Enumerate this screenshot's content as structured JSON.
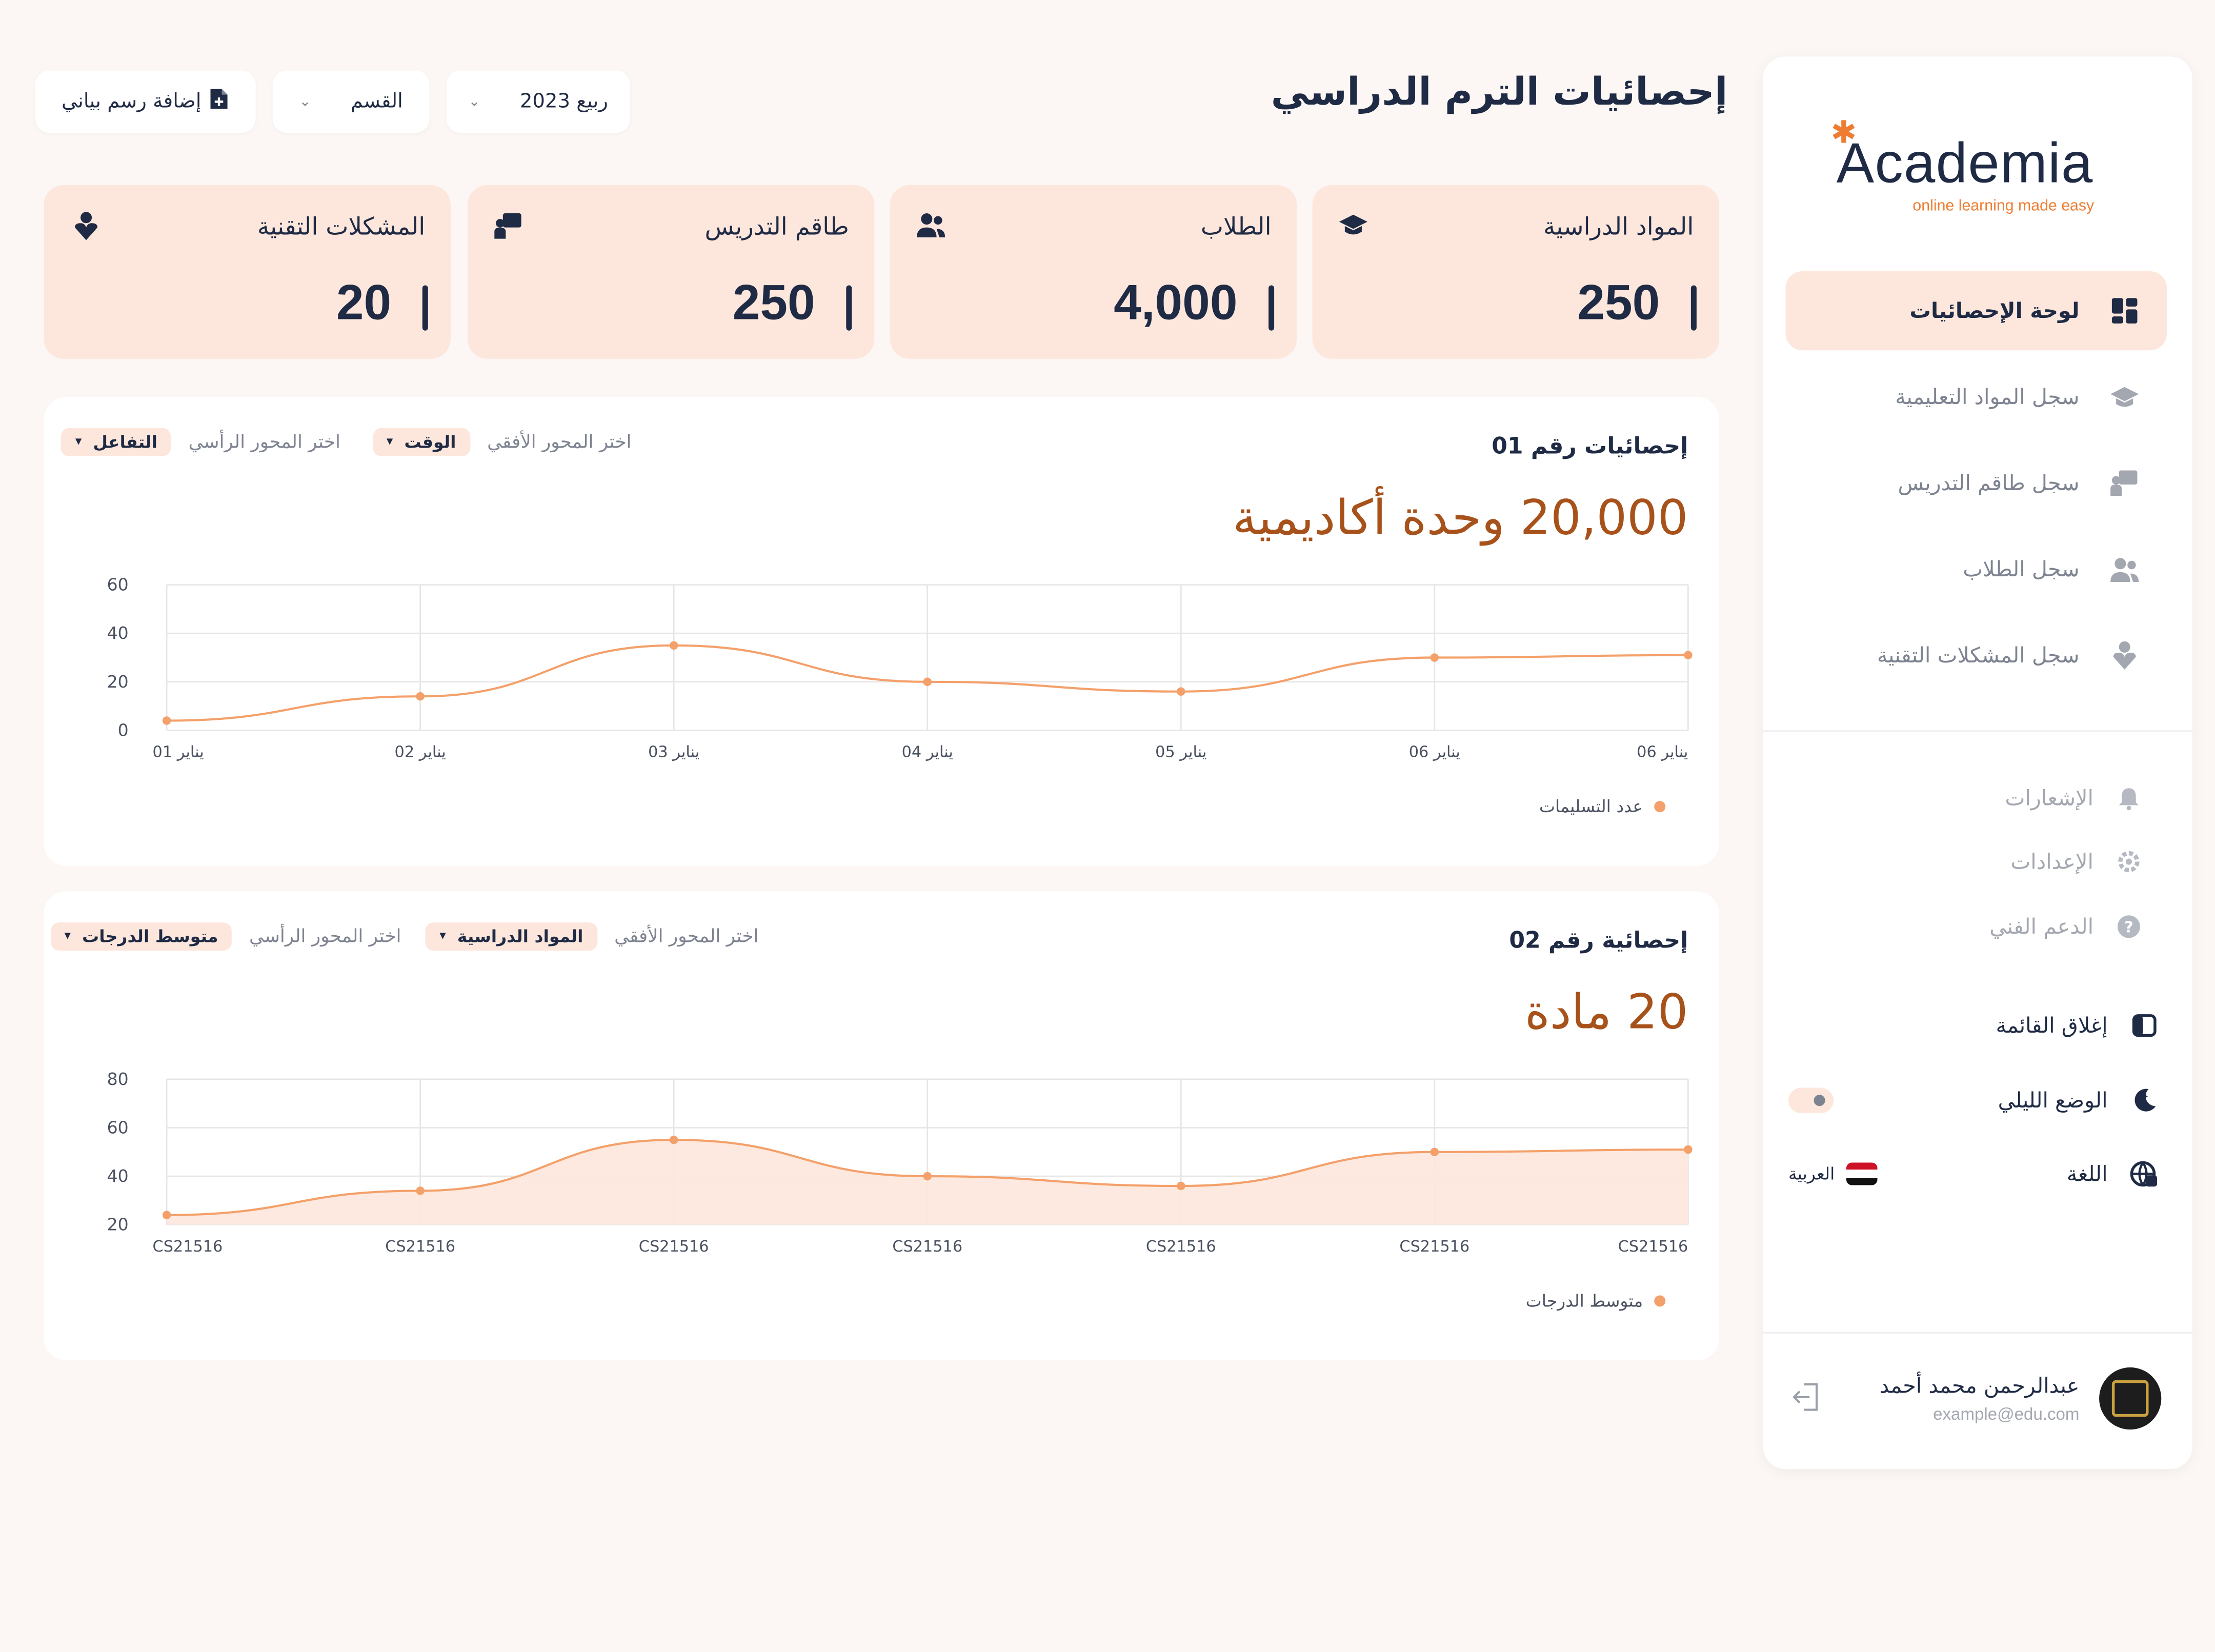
{
  "brand": {
    "name": "Academia",
    "tagline": "online learning made easy",
    "accent": "#ee7d33"
  },
  "sidebar": {
    "items": [
      {
        "label": "لوحة الإحصائيات",
        "icon": "dashboard-icon",
        "active": true
      },
      {
        "label": "سجل المواد التعليمية",
        "icon": "graduation-cap-icon"
      },
      {
        "label": "سجل طاقم التدريس",
        "icon": "teacher-icon"
      },
      {
        "label": "سجل الطلاب",
        "icon": "students-icon"
      },
      {
        "label": "سجل المشكلات التقنية",
        "icon": "issue-icon"
      }
    ],
    "secondary": [
      {
        "label": "الإشعارات",
        "icon": "bell-icon"
      },
      {
        "label": "الإعدادات",
        "icon": "gear-icon"
      },
      {
        "label": "الدعم الفني",
        "icon": "help-icon"
      }
    ],
    "collapse_label": "إغلاق القائمة",
    "night_mode_label": "الوضع الليلي",
    "language_label": "اللغة",
    "language_value": "العربية",
    "user": {
      "name": "عبدالرحمن محمد أحمد",
      "email": "example@edu.com"
    }
  },
  "header": {
    "title": "إحصائيات الترم الدراسي",
    "term_select": "ربيع 2023",
    "dept_select": "القسم",
    "add_chart_label": "إضافة رسم بياني"
  },
  "stats": [
    {
      "title": "المواد الدراسية",
      "value": "250",
      "icon": "graduation-cap-icon"
    },
    {
      "title": "الطلاب",
      "value": "4,000",
      "icon": "students-icon"
    },
    {
      "title": "طاقم التدريس",
      "value": "250",
      "icon": "teacher-icon"
    },
    {
      "title": "المشكلات التقنية",
      "value": "20",
      "icon": "issue-icon"
    }
  ],
  "panels": [
    {
      "title": "إحصائيات رقم 01",
      "headline": "20,000 وحدة أكاديمية",
      "x_axis_label": "اختر المحور الأفقي",
      "x_axis_value": "الوقت",
      "y_axis_label": "اختر المحور الرأسي",
      "y_axis_value": "التفاعل",
      "legend": "عدد التسليمات"
    },
    {
      "title": "إحصائية رقم 02",
      "headline": "20 مادة",
      "x_axis_label": "اختر المحور الأفقي",
      "x_axis_value": "المواد الدراسية",
      "y_axis_label": "اختر المحور الرأسي",
      "y_axis_value": "متوسط الدرجات",
      "legend": "متوسط الدرجات"
    }
  ],
  "chart_data": [
    {
      "type": "line",
      "categories": [
        "01 يناير",
        "02 يناير",
        "03 يناير",
        "04 يناير",
        "05 يناير",
        "06 يناير",
        "06 يناير"
      ],
      "series": [
        {
          "name": "عدد التسليمات",
          "values": [
            4,
            14,
            35,
            20,
            16,
            30,
            31
          ]
        }
      ],
      "ylim": [
        0,
        60
      ],
      "yticks": [
        0,
        20,
        40,
        60
      ],
      "grid": true,
      "legend": "bottom-right",
      "color": "#f4a06a"
    },
    {
      "type": "area",
      "categories": [
        "CS21516",
        "CS21516",
        "CS21516",
        "CS21516",
        "CS21516",
        "CS21516",
        "CS21516"
      ],
      "series": [
        {
          "name": "متوسط الدرجات",
          "values": [
            24,
            34,
            55,
            40,
            36,
            50,
            51
          ]
        }
      ],
      "ylim": [
        20,
        80
      ],
      "yticks": [
        20,
        40,
        60,
        80
      ],
      "grid": true,
      "legend": "bottom-right",
      "color": "#f4a06a"
    }
  ]
}
